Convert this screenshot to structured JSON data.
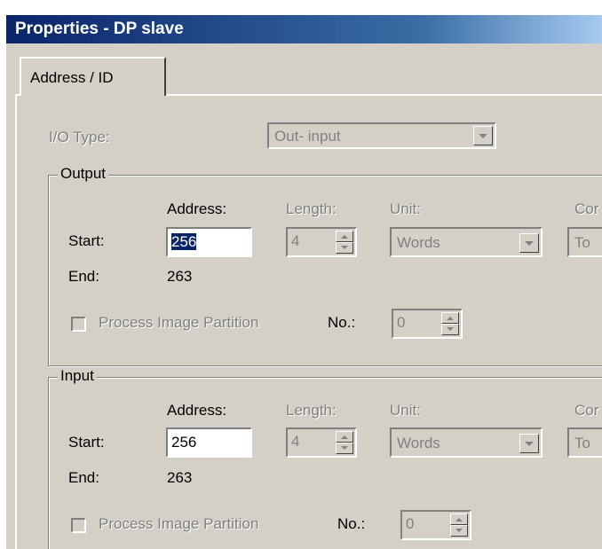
{
  "window": {
    "title": "Properties - DP slave"
  },
  "tabs": [
    {
      "label": "Address / ID"
    }
  ],
  "io_type": {
    "label": "I/O Type:",
    "value": "Out- input"
  },
  "output": {
    "group_title": "Output",
    "address_header": "Address:",
    "length_header": "Length:",
    "unit_header": "Unit:",
    "consistency_header": "Cor",
    "start_label": "Start:",
    "end_label": "End:",
    "start_address": "256",
    "end_address": "263",
    "length": "4",
    "unit": "Words",
    "consistency": "To",
    "process_image_label": "Process Image Partition",
    "no_label": "No.:",
    "no_value": "0"
  },
  "input": {
    "group_title": "Input",
    "address_header": "Address:",
    "length_header": "Length:",
    "unit_header": "Unit:",
    "consistency_header": "Cor",
    "start_label": "Start:",
    "end_label": "End:",
    "start_address": "256",
    "end_address": "263",
    "length": "4",
    "unit": "Words",
    "consistency": "To",
    "process_image_label": "Process Image Partition",
    "no_label": "No.:",
    "no_value": "0"
  }
}
